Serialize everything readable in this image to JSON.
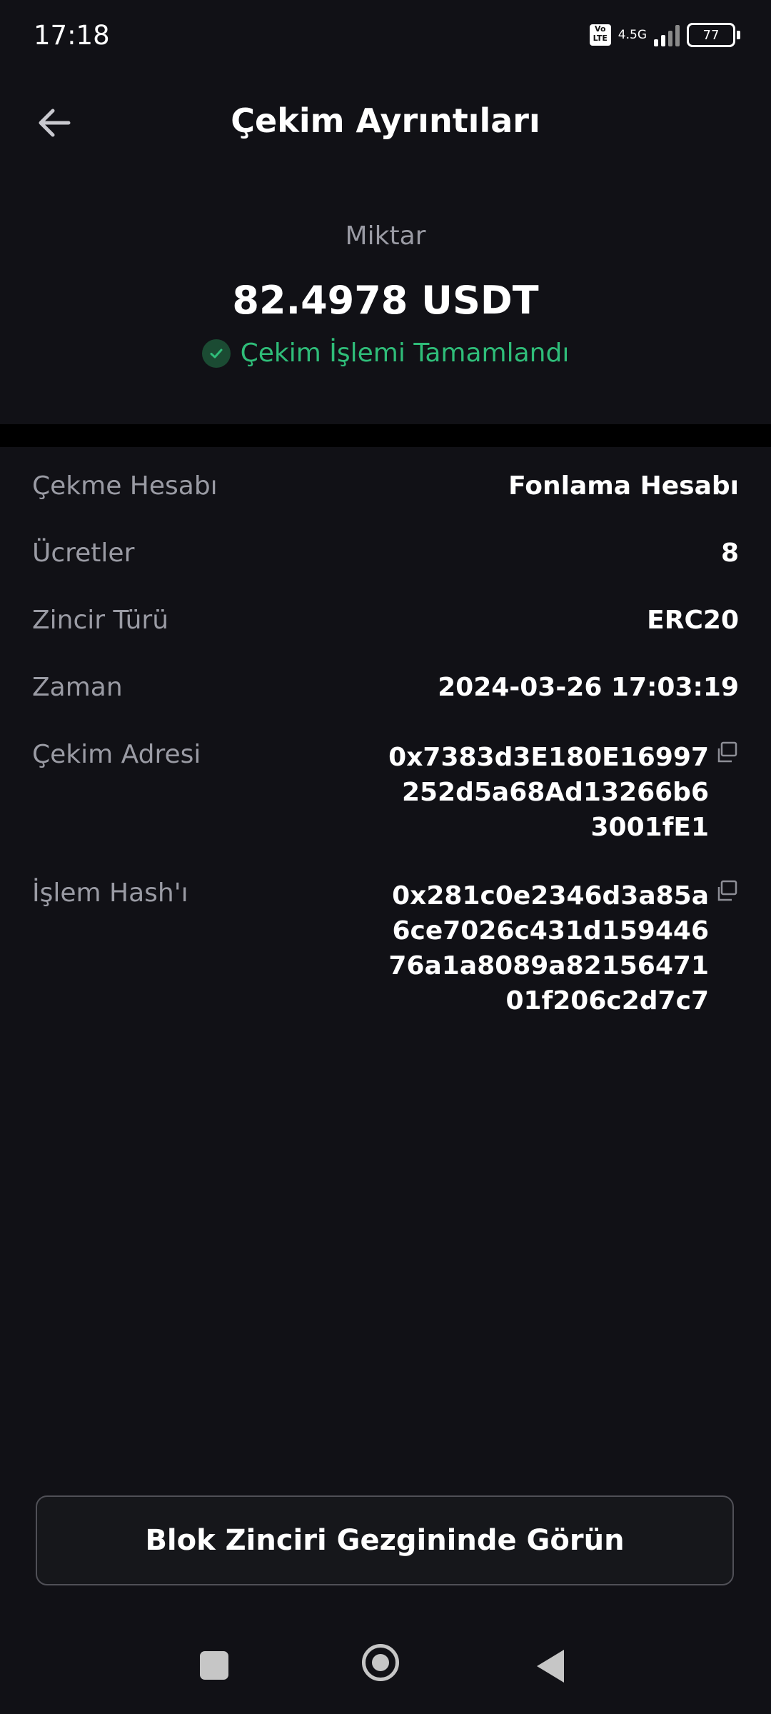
{
  "status_bar": {
    "time": "17:18",
    "volte": "Vo LTE",
    "network": "4.5G",
    "battery": "77"
  },
  "header": {
    "title": "Çekim Ayrıntıları"
  },
  "summary": {
    "amount_label": "Miktar",
    "amount": "82.4978 USDT",
    "status": "Çekim İşlemi Tamamlandı",
    "status_color": "#2fbd79"
  },
  "details": {
    "account_label": "Çekme Hesabı",
    "account_value": "Fonlama Hesabı",
    "fees_label": "Ücretler",
    "fees_value": "8",
    "chain_label": "Zincir Türü",
    "chain_value": "ERC20",
    "time_label": "Zaman",
    "time_value": "2024-03-26 17:03:19",
    "address_label": "Çekim Adresi",
    "address_lines": [
      "0x7383d3E180E16997",
      "252d5a68Ad13266b6",
      "3001fE1"
    ],
    "hash_label": "İşlem Hash'ı",
    "hash_lines": [
      "0x281c0e2346d3a85a",
      "6ce7026c431d159446",
      "76a1a8089a82156471",
      "01f206c2d7c7"
    ]
  },
  "cta": {
    "label": "Blok Zinciri Gezgininde Görün"
  },
  "icons": {
    "back": "arrow-left-icon",
    "copy": "copy-icon",
    "check": "check-circle-icon"
  }
}
